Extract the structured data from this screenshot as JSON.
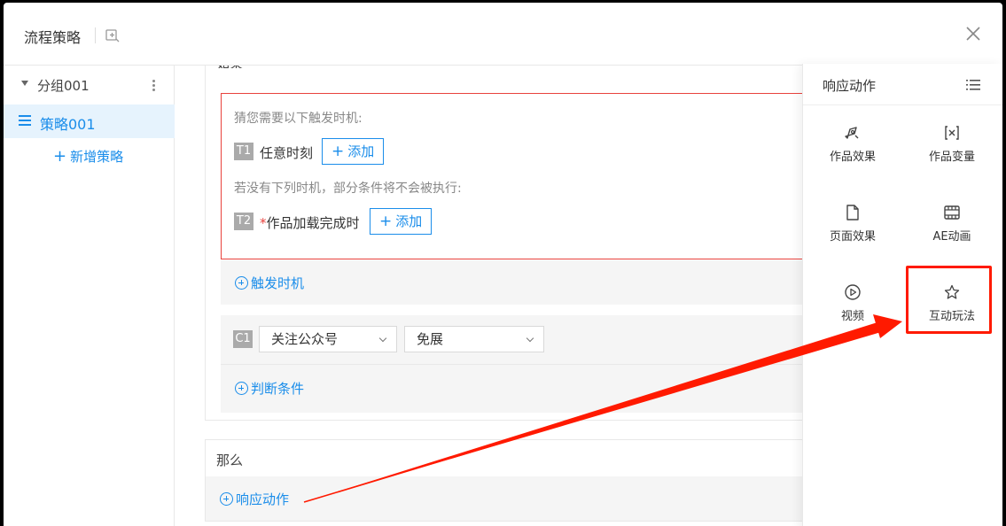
{
  "header": {
    "title": "流程策略",
    "title_icon": "export-icon",
    "close_icon": "close-icon"
  },
  "sidebar": {
    "group": {
      "label": "分组001"
    },
    "strategy": {
      "label": "策略001"
    },
    "add_strategy": {
      "plus": "+",
      "label": "新增策略"
    }
  },
  "if_section": {
    "title": "如果",
    "trigger_box": {
      "hint1": "猜您需要以下触发时机:",
      "t1": {
        "badge": "T1",
        "label": "任意时刻",
        "add_label": "添加"
      },
      "hint2": "若没有下列时机，部分条件将不会被执行:",
      "t2": {
        "badge": "T2",
        "required_mark": "*",
        "label": "作品加载完成时",
        "add_label": "添加"
      }
    },
    "add_trigger_label": "触发时机",
    "condition": {
      "badge": "C1",
      "select1": "关注公众号",
      "select2": "免展"
    },
    "add_condition_label": "判断条件"
  },
  "then_section": {
    "title": "那么",
    "add_action_label": "响应动作"
  },
  "panel": {
    "title": "响应动作",
    "items": [
      {
        "label": "作品效果",
        "icon": "pen-nib-icon"
      },
      {
        "label": "作品变量",
        "icon": "variable-x-icon"
      },
      {
        "label": "页面效果",
        "icon": "file-icon"
      },
      {
        "label": "AE动画",
        "icon": "film-icon"
      },
      {
        "label": "视频",
        "icon": "play-circle-icon"
      },
      {
        "label": "互动玩法",
        "icon": "star-icon"
      }
    ]
  },
  "annotation": {
    "color": "#ff1a00"
  },
  "colors": {
    "accent": "#1a8dea",
    "error": "#e8423d"
  }
}
